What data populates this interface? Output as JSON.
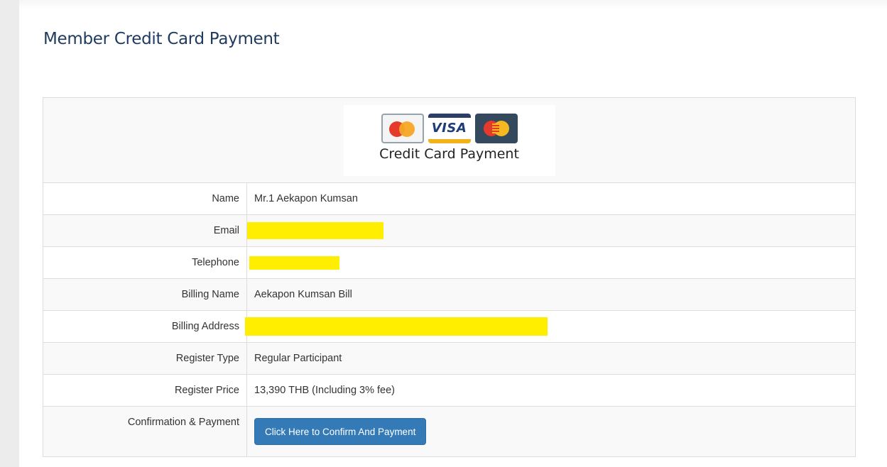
{
  "page": {
    "title": "Member Credit Card Payment"
  },
  "header": {
    "logo_caption": "Credit Card Payment",
    "visa_text": "VISA",
    "card_icons": [
      "mastercard-icon",
      "visa-icon",
      "maestro-icon"
    ]
  },
  "rows": [
    {
      "label": "Name",
      "value": "Mr.1 Aekapon Kumsan"
    },
    {
      "label": "Email",
      "value": ""
    },
    {
      "label": "Telephone",
      "value": ""
    },
    {
      "label": "Billing Name",
      "value": "Aekapon Kumsan Bill"
    },
    {
      "label": "Billing Address",
      "value": ""
    },
    {
      "label": "Register Type",
      "value": "Regular Participant"
    },
    {
      "label": "Register Price",
      "value": "13,390 THB (Including 3% fee)"
    },
    {
      "label": "Confirmation & Payment"
    }
  ],
  "confirm_button": {
    "label": "Click Here to Confirm And Payment"
  },
  "colors": {
    "title": "#1f3a5f",
    "button": "#337ab7",
    "redaction": "#ffee00"
  }
}
